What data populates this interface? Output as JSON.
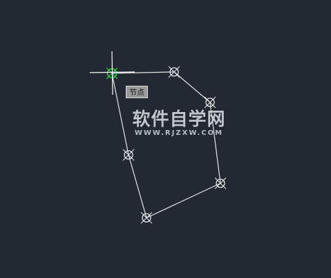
{
  "canvas": {
    "background": "#222933",
    "line_color": "#e8e8e8",
    "active_color": "#2ecf44"
  },
  "tooltip": {
    "label": "节点"
  },
  "watermark": {
    "title": "软件自学网",
    "url": "WWW.RJZXW.COM"
  },
  "icons": {
    "node": "node-marker-icon",
    "cursor": "crosshair-cursor-icon"
  }
}
